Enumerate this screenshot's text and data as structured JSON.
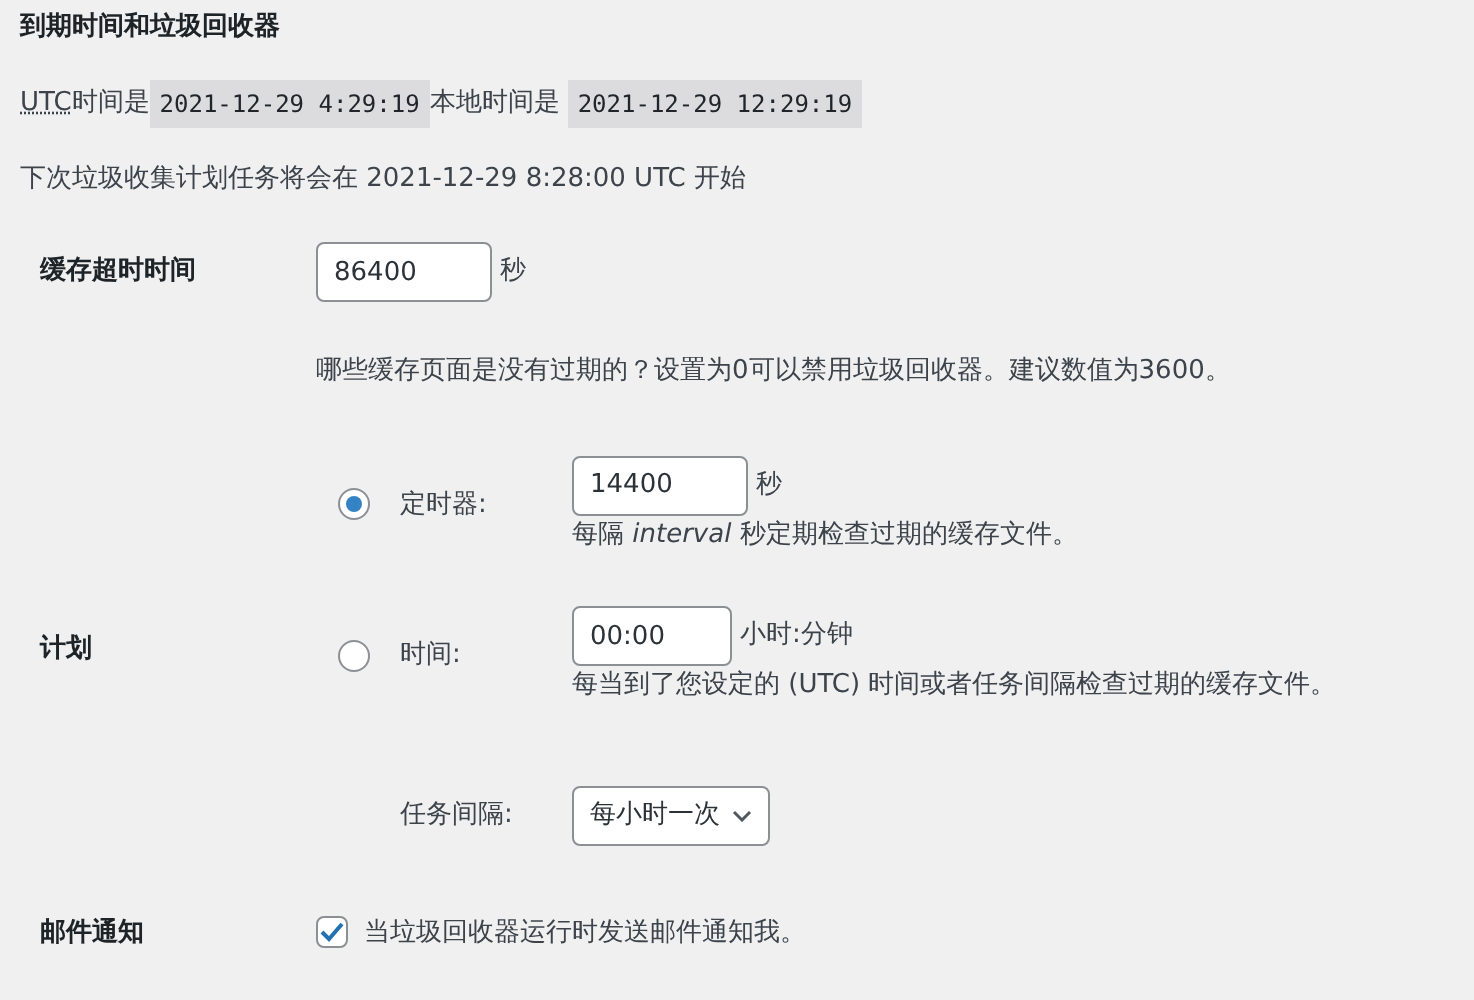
{
  "section_title": "到期时间和垃圾回收器",
  "time_line": {
    "utc_abbr": "UTC",
    "utc_label": "时间是",
    "utc_time": "2021-12-29 4:29:19",
    "local_label": "本地时间是",
    "local_time": "2021-12-29 12:29:19"
  },
  "next_run": "下次垃圾收集计划任务将会在 2021-12-29 8:28:00 UTC 开始",
  "cache_timeout": {
    "label": "缓存超时时间",
    "value": "86400",
    "unit": "秒",
    "description": "哪些缓存页面是没有过期的？设置为0可以禁用垃圾回收器。建议数值为3600。"
  },
  "schedule": {
    "label": "计划",
    "options": [
      {
        "kind": "timer",
        "label": "定时器:",
        "selected": true,
        "value": "14400",
        "unit": "秒",
        "hint": "每隔 *interval* 秒定期检查过期的缓存文件。"
      },
      {
        "kind": "clock",
        "label": "时间:",
        "selected": false,
        "value": "00:00",
        "unit": "小时:分钟",
        "hint": "每当到了您设定的 (UTC) 时间或者任务间隔检查过期的缓存文件。"
      }
    ],
    "interval": {
      "label": "任务间隔:",
      "value": "每小时一次"
    }
  },
  "email": {
    "label": "邮件通知",
    "checked": true,
    "text": "当垃圾回收器运行时发送邮件通知我。"
  }
}
